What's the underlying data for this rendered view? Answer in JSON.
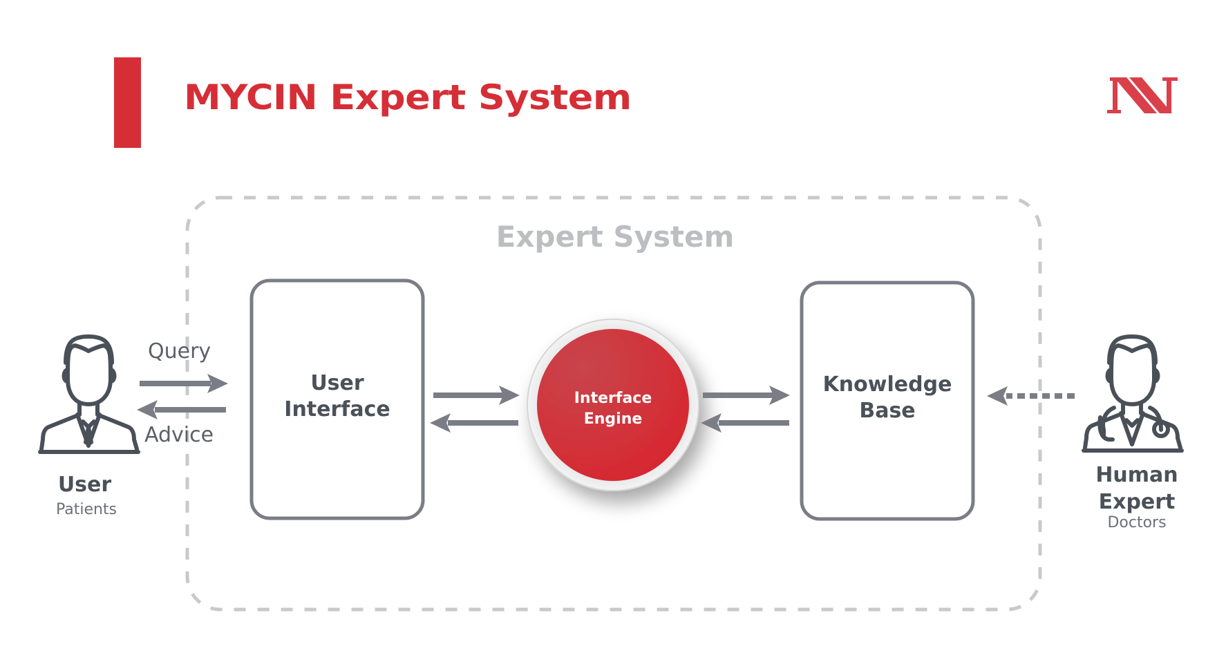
{
  "header": {
    "title": "MYCIN Expert System",
    "logo": "NN-logo-icon",
    "accent_color": "#d62e36"
  },
  "diagram": {
    "container_label": "Expert System",
    "components": [
      {
        "id": "user-interface",
        "label_line1": "User",
        "label_line2": "Interface"
      },
      {
        "id": "interface-engine",
        "label_line1": "Interface",
        "label_line2": "Engine"
      },
      {
        "id": "knowledge-base",
        "label_line1": "Knowledge",
        "label_line2": "Base"
      }
    ],
    "actors": {
      "user": {
        "name": "User",
        "role": "Patients",
        "icon": "user-person-icon"
      },
      "expert": {
        "name_line1": "Human",
        "name_line2": "Expert",
        "role": "Doctors",
        "icon": "doctor-icon"
      }
    },
    "flows": {
      "query": "Query",
      "advice": "Advice"
    },
    "colors": {
      "box_stroke": "#7a7d85",
      "arrow": "#7a7d85",
      "dashed_border": "#c8c9cc",
      "engine_fill": "#d62e36",
      "text_dark": "#4b5159"
    }
  }
}
